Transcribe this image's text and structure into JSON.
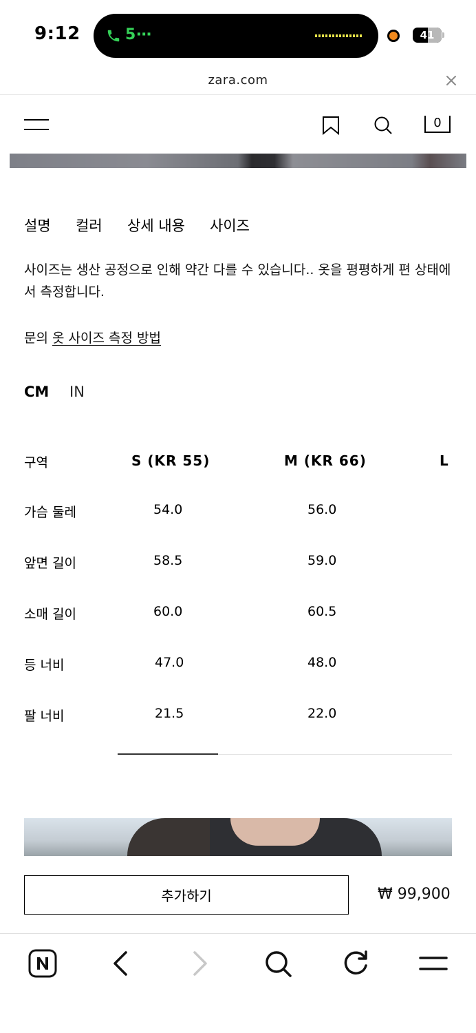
{
  "status_bar": {
    "time": "9:12",
    "call_timer": "5⋯",
    "battery_level": "41"
  },
  "browser": {
    "url": "zara.com"
  },
  "site_header": {
    "bag_count": "0"
  },
  "tabs": [
    {
      "label": "설명"
    },
    {
      "label": "컬러"
    },
    {
      "label": "상세 내용"
    },
    {
      "label": "사이즈"
    }
  ],
  "description": "사이즈는 생산 공정으로 인해 약간 다를 수 있습니다.. 옷을 평평하게 편 상태에서 측정합니다.",
  "inquiry": {
    "prefix": "문의",
    "link_text": "옷 사이즈 측정 방법"
  },
  "units": {
    "cm": "CM",
    "in": "IN",
    "selected": "CM"
  },
  "size_table": {
    "headers": [
      "구역",
      "S (KR 55)",
      "M (KR 66)",
      "L"
    ],
    "rows": [
      {
        "label": "가슴 둘레",
        "values": [
          "54.0",
          "56.0"
        ]
      },
      {
        "label": "앞면 길이",
        "values": [
          "58.5",
          "59.0"
        ]
      },
      {
        "label": "소매 길이",
        "values": [
          "60.0",
          "60.5"
        ]
      },
      {
        "label": "등 너비",
        "values": [
          "47.0",
          "48.0"
        ]
      },
      {
        "label": "팔 너비",
        "values": [
          "21.5",
          "22.0"
        ]
      }
    ]
  },
  "purchase": {
    "add_label": "추가하기",
    "price": "₩ 99,900"
  },
  "colors": {
    "call_green": "#35d158",
    "recording_orange": "#f28a1d"
  },
  "icons": [
    "phone-icon",
    "close-icon",
    "menu-icon",
    "bookmark-icon",
    "search-icon",
    "bag-icon",
    "naver-icon",
    "back-icon",
    "forward-icon",
    "refresh-icon"
  ]
}
